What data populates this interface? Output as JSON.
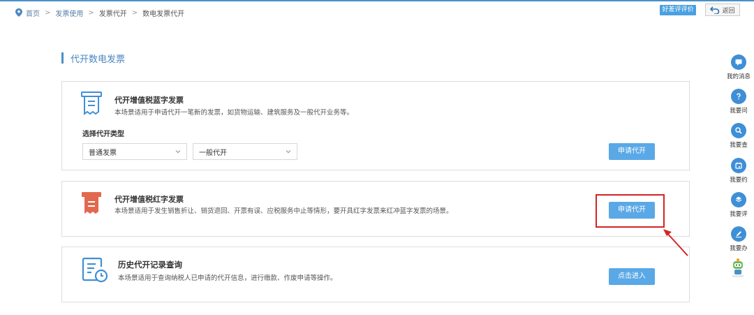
{
  "breadcrumb": {
    "items": [
      "首页",
      "发票使用",
      "发票代开",
      "数电发票代开"
    ],
    "separator": ">"
  },
  "header": {
    "rate_button": "好差评评价",
    "back_button": "返回"
  },
  "section": {
    "title": "代开数电发票"
  },
  "cards": [
    {
      "title": "代开增值税蓝字发票",
      "description": "本场景适用于申请代开一笔新的发票，如货物运输、建筑服务及一般代开业务等。",
      "type_label": "选择代开类型",
      "select1": "普通发票",
      "select2": "一般代开",
      "button": "申请代开",
      "icon": "blue-invoice-icon"
    },
    {
      "title": "代开增值税红字发票",
      "description": "本场景适用于发生销售折让、销货退回、开票有误、应税服务中止等情形，要开具红字发票来红冲蓝字发票的场景。",
      "button": "申请代开",
      "icon": "red-invoice-icon"
    },
    {
      "title": "历史代开记录查询",
      "description": "本场景适用于查询纳税人已申请的代开信息，进行缴款、作废申请等操作。",
      "button": "点击进入",
      "icon": "history-record-icon"
    }
  ],
  "sidebar": {
    "items": [
      {
        "label": "我的消息",
        "icon": "message-icon"
      },
      {
        "label": "我要问",
        "icon": "question-icon"
      },
      {
        "label": "我要查",
        "icon": "search-icon"
      },
      {
        "label": "我要约",
        "icon": "calendar-icon"
      },
      {
        "label": "我要评",
        "icon": "rate-icon"
      },
      {
        "label": "我要办",
        "icon": "edit-icon"
      }
    ]
  },
  "colors": {
    "primary": "#5aa8e6",
    "accent_blue": "#3f8fd6",
    "red_icon": "#e2694f",
    "highlight": "#d22525"
  }
}
